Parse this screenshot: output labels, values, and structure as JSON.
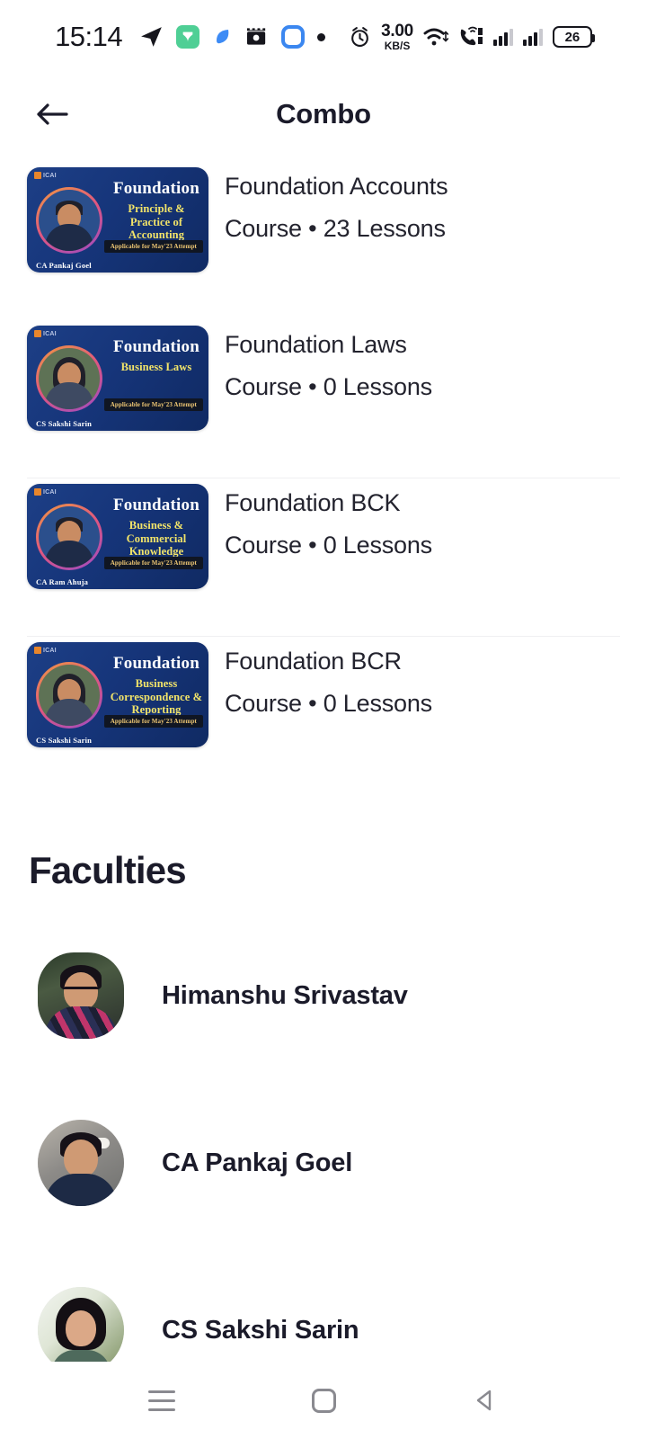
{
  "status_bar": {
    "time": "15:14",
    "network_speed_value": "3.00",
    "network_speed_unit": "KB/S",
    "battery_level": "26",
    "icons": [
      "telegram-icon",
      "green-app-icon",
      "blue-app-icon",
      "dark-app-icon",
      "outline-app-icon",
      "dot-indicator",
      "alarm-icon",
      "wifi-icon",
      "vowifi-icon",
      "signal-sim1-icon",
      "signal-sim2-icon",
      "battery-icon"
    ]
  },
  "app_bar": {
    "back_icon": "arrow-left-icon",
    "title": "Combo"
  },
  "courses": [
    {
      "title": "Foundation Accounts",
      "meta": "Course • 23 Lessons",
      "thumb": {
        "brand": "ICAI",
        "main": "Foundation",
        "sub": "Principle & Practice of Accounting",
        "badge": "Applicable for May'23 Attempt",
        "faculty": "CA Pankaj Goel"
      }
    },
    {
      "title": "Foundation Laws",
      "meta": "Course • 0 Lessons",
      "thumb": {
        "brand": "ICAI",
        "main": "Foundation",
        "sub": "Business Laws",
        "badge": "Applicable for May'23 Attempt",
        "faculty": "CS Sakshi Sarin"
      }
    },
    {
      "title": "Foundation BCK",
      "meta": "Course • 0 Lessons",
      "thumb": {
        "brand": "ICAI",
        "main": "Foundation",
        "sub": "Business & Commercial Knowledge",
        "badge": "Applicable for May'23 Attempt",
        "faculty": "CA Ram Ahuja"
      }
    },
    {
      "title": "Foundation BCR",
      "meta": "Course • 0 Lessons",
      "thumb": {
        "brand": "ICAI",
        "main": "Foundation",
        "sub": "Business Correspondence & Reporting",
        "badge": "Applicable for May'23 Attempt",
        "faculty": "CS Sakshi Sarin"
      }
    }
  ],
  "faculties_section": {
    "heading": "Faculties",
    "items": [
      {
        "name": "Himanshu Srivastav"
      },
      {
        "name": "CA Pankaj Goel"
      },
      {
        "name": "CS Sakshi Sarin"
      }
    ]
  },
  "nav_bar": {
    "recents_icon": "hamburger-icon",
    "home_icon": "square-home-icon",
    "back_icon": "triangle-back-icon"
  },
  "colors": {
    "text_primary": "#1b1b2a",
    "text_body": "#23232e",
    "divider": "#f0f0f2",
    "thumb_blue": "#16357a",
    "thumb_yellow": "#f2e469",
    "accent_orange": "#e8862c",
    "nav_gray": "#8a8a90",
    "background": "#ffffff"
  }
}
